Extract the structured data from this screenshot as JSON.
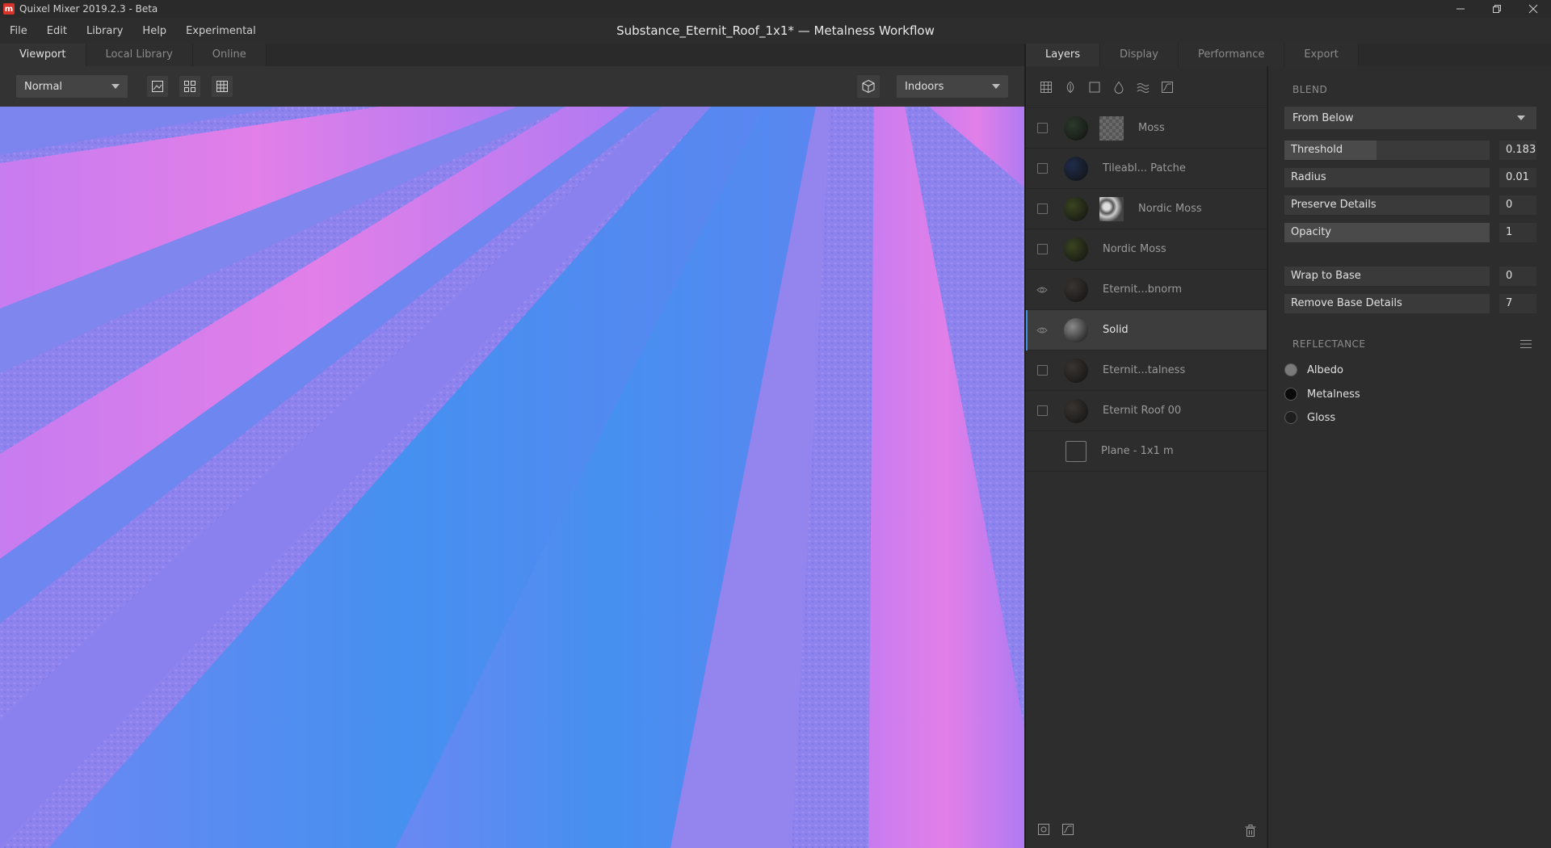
{
  "window": {
    "app_title": "Quixel Mixer 2019.2.3 - Beta",
    "doc_title": "Substance_Eternit_Roof_1x1* — Metalness Workflow",
    "controls": [
      "minimize-icon",
      "restore-icon",
      "close-icon"
    ]
  },
  "menu": {
    "items": [
      "File",
      "Edit",
      "Library",
      "Help",
      "Experimental"
    ]
  },
  "left_tabs": [
    "Viewport",
    "Local Library",
    "Online"
  ],
  "viewport_toolbar": {
    "mode": "Normal",
    "environment": "Indoors"
  },
  "right_tabs": [
    "Layers",
    "Display",
    "Performance",
    "Export"
  ],
  "layers": [
    {
      "name": "Moss",
      "state": "unchecked",
      "thumb": "#2c3a2c",
      "mask": "checker"
    },
    {
      "name": "Tileabl... Patche",
      "state": "unchecked",
      "thumb": "#1f2c4a",
      "mask": ""
    },
    {
      "name": "Nordic Moss",
      "state": "unchecked",
      "thumb": "#3a4420",
      "mask": "noise"
    },
    {
      "name": "Nordic Moss",
      "state": "unchecked",
      "thumb": "#3a4420",
      "mask": ""
    },
    {
      "name": "Eternit...bnorm",
      "state": "visible",
      "thumb": "#3a3532",
      "mask": ""
    },
    {
      "name": "Solid",
      "state": "visible",
      "thumb": "#8a8a8a",
      "mask": ""
    },
    {
      "name": "Eternit...talness",
      "state": "unchecked",
      "thumb": "#3a3532",
      "mask": ""
    },
    {
      "name": "Eternit Roof 00",
      "state": "unchecked",
      "thumb": "#3a3532",
      "mask": ""
    },
    {
      "name": "Plane - 1x1 m",
      "state": "none",
      "thumb": "",
      "mask": ""
    }
  ],
  "selected_layer": "Solid",
  "blend": {
    "section": "BLEND",
    "mode": "From Below",
    "params": [
      {
        "label": "Threshold",
        "value": "0.183",
        "fill": 0.45
      },
      {
        "label": "Radius",
        "value": "0.01",
        "fill": 0.0
      },
      {
        "label": "Preserve Details",
        "value": "0",
        "fill": 0.0
      },
      {
        "label": "Opacity",
        "value": "1",
        "fill": 1.0
      },
      {
        "label": "Wrap to Base",
        "value": "0",
        "fill": 0.0
      },
      {
        "label": "Remove Base Details",
        "value": "7",
        "fill": 0.0
      }
    ]
  },
  "reflectance": {
    "section": "REFLECTANCE",
    "items": [
      {
        "label": "Albedo",
        "color": "#7a7a7a"
      },
      {
        "label": "Metalness",
        "color": "#0a0a0a"
      },
      {
        "label": "Gloss",
        "color": "#1e1e1e"
      }
    ]
  },
  "colors": {
    "accent": "#3a8ee6",
    "viewport_pink": "#d97ef0",
    "viewport_blue": "#4a8cf0",
    "viewport_violet": "#8b7cf0"
  }
}
